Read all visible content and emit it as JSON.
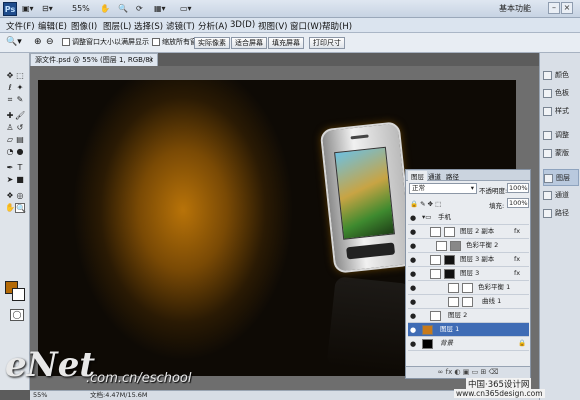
{
  "appbar": {
    "zoom": "55%",
    "workspace": "基本功能",
    "min": "–",
    "max": "□",
    "close": "×"
  },
  "menu": [
    "文件(F)",
    "编辑(E)",
    "图像(I)",
    "图层(L)",
    "选择(S)",
    "滤镜(T)",
    "分析(A)",
    "3D(D)",
    "视图(V)",
    "窗口(W)",
    "帮助(H)"
  ],
  "options": {
    "resize_windows": "调整窗口大小以满屏显示",
    "zoom_all": "缩放所有窗口",
    "actual_pixels": "实际像素",
    "fit_screen": "适合屏幕",
    "fill_screen": "填充屏幕",
    "print_size": "打印尺寸"
  },
  "document": {
    "tab_title": "源文件.psd @ 55% (图层 1, RGB/8) *",
    "zoom_status": "55%",
    "doc_size": "文档:4.47M/15.6M"
  },
  "dock": [
    "颜色",
    "色板",
    "样式",
    "调整",
    "蒙版",
    "图层",
    "通道",
    "路径"
  ],
  "layers_panel": {
    "tabs": [
      "图层",
      "通道",
      "路径"
    ],
    "blend_mode": "正常",
    "opacity_label": "不透明度:",
    "opacity_value": "100%",
    "fill_label": "填充:",
    "fill_value": "100%",
    "layers": [
      {
        "name": "手机"
      },
      {
        "name": "图层 2 副本"
      },
      {
        "name": "色彩平衡 2"
      },
      {
        "name": "图层 3 副本"
      },
      {
        "name": "图层 3"
      },
      {
        "name": "色彩平衡 1"
      },
      {
        "name": "曲线 1"
      },
      {
        "name": "图层 2"
      },
      {
        "name": "图层 1"
      },
      {
        "name": "背景"
      }
    ],
    "footer": "∞ fx ◐ ▣ ▭ ⊞ ⌫"
  },
  "colors": {
    "foreground": "#b36906",
    "background": "#ffffff"
  },
  "watermark": {
    "brand": "eNet",
    "url": ".com.cn/eschool",
    "right_line1": "中国·365设计网",
    "right_line2": "www.cn365design.com"
  }
}
